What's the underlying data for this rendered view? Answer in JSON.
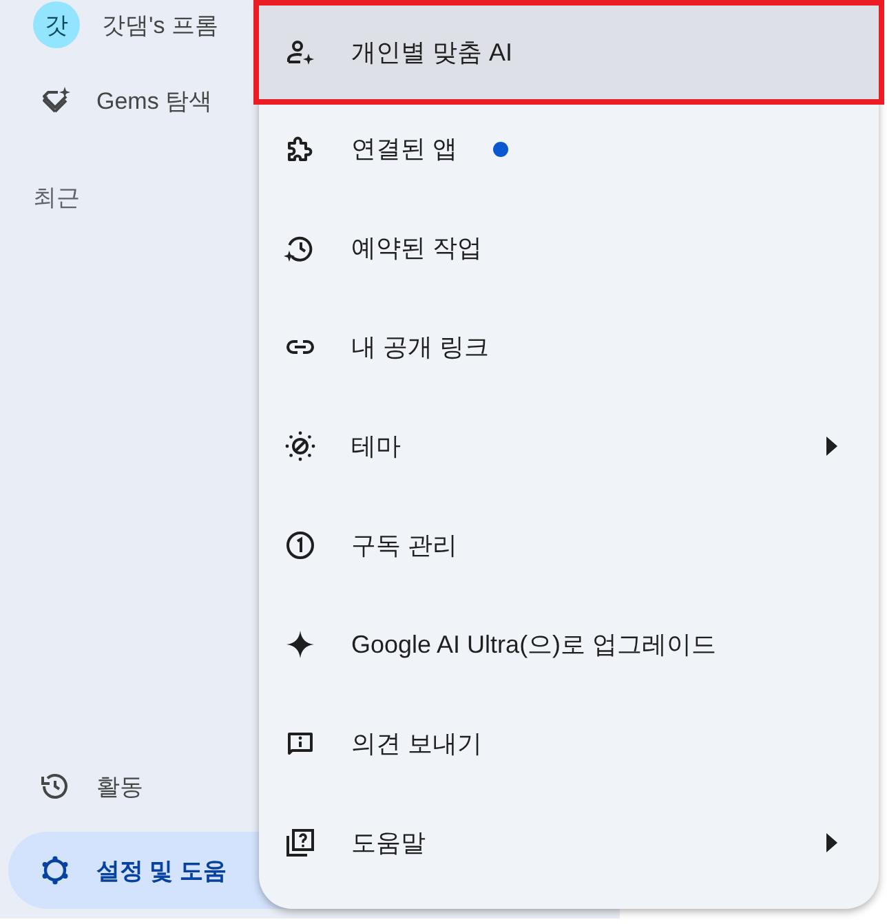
{
  "sidebar": {
    "items": [
      {
        "kind": "avatar",
        "avatar_text": "갓",
        "label": "갓댐's 프롬",
        "selected": false
      },
      {
        "kind": "gems",
        "label": "Gems 탐색",
        "selected": false
      }
    ],
    "section_heading": "최근",
    "bottom_items": [
      {
        "kind": "activity",
        "label": "활동",
        "selected": false
      },
      {
        "kind": "settings",
        "label": "설정 및 도움",
        "selected": true
      }
    ]
  },
  "menu": {
    "items": [
      {
        "label": "개인별 맞춤 AI",
        "selected": true,
        "has_submenu": false
      },
      {
        "label": "연결된 앱",
        "selected": false,
        "has_submenu": false,
        "color": "#0b57d0"
      },
      {
        "label": "예약된 작업",
        "selected": false,
        "has_submenu": false
      },
      {
        "label": "내 공개 링크",
        "selected": false,
        "has_submenu": false
      },
      {
        "label": "테마",
        "selected": false,
        "has_submenu": true
      },
      {
        "label": "구독 관리",
        "selected": false,
        "has_submenu": false
      },
      {
        "label": "Google AI Ultra(으)로 업그레이드",
        "selected": false,
        "has_submenu": false
      },
      {
        "label": "의견 보내기",
        "selected": false,
        "has_submenu": false
      },
      {
        "label": "도움말",
        "selected": false,
        "has_submenu": true
      }
    ]
  }
}
